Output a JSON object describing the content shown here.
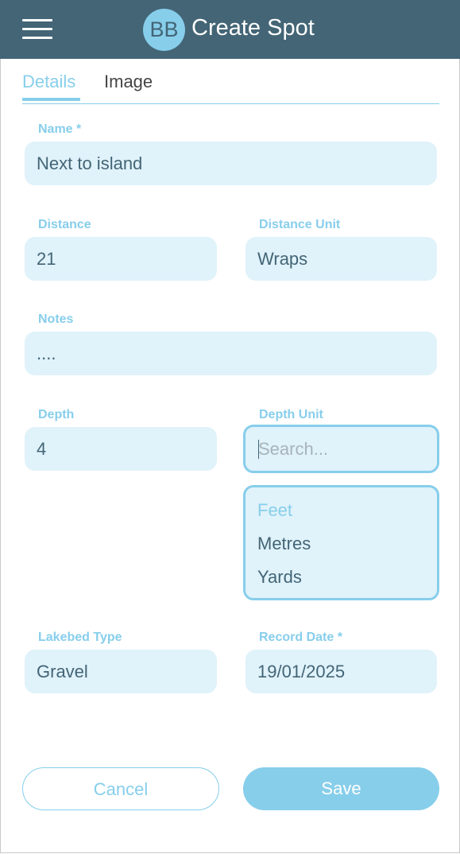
{
  "header": {
    "logo_text": "BB",
    "title": "Create Spot"
  },
  "tabs": [
    {
      "label": "Details",
      "active": true
    },
    {
      "label": "Image",
      "active": false
    }
  ],
  "form": {
    "name": {
      "label": "Name *",
      "value": "Next to island"
    },
    "distance": {
      "label": "Distance",
      "value": "21"
    },
    "distance_unit": {
      "label": "Distance Unit",
      "value": "Wraps"
    },
    "notes": {
      "label": "Notes",
      "value": "...."
    },
    "depth": {
      "label": "Depth",
      "value": "4"
    },
    "depth_unit": {
      "label": "Depth Unit",
      "search_placeholder": "Search...",
      "options": [
        "Feet",
        "Metres",
        "Yards"
      ],
      "highlighted": "Feet"
    },
    "lakebed_type": {
      "label": "Lakebed Type",
      "value": "Gravel"
    },
    "record_date": {
      "label": "Record Date *",
      "value": "19/01/2025"
    }
  },
  "actions": {
    "cancel_label": "Cancel",
    "save_label": "Save"
  },
  "colors": {
    "header_bg": "#436576",
    "accent": "#87ceeb",
    "field_bg": "#e0f2fa",
    "text": "#436576"
  }
}
